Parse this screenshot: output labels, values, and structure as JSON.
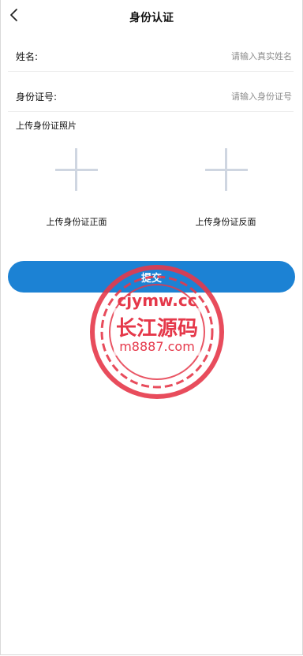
{
  "header": {
    "title": "身份认证"
  },
  "form": {
    "name_label": "姓名:",
    "name_placeholder": "请输入真实姓名",
    "id_label": "身份证号:",
    "id_placeholder": "请输入身份证号",
    "photo_section_title": "上传身份证照片",
    "front_label": "上传身份证正面",
    "back_label": "上传身份证反面",
    "submit_label": "提交"
  },
  "watermark": {
    "line1": "cjymw.cc",
    "line2": "长江源码",
    "line3": "m8887.com",
    "color": "#e5384a"
  },
  "colors": {
    "accent": "#1c82d4",
    "plus_icon": "#cfd6e1"
  }
}
